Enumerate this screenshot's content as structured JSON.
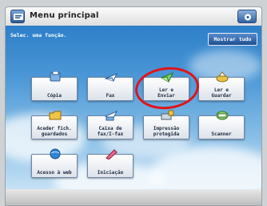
{
  "window": {
    "title": "Menu principal"
  },
  "screen": {
    "subtitle": "Selec. uma função.",
    "show_all_label": "Mostrar tudo"
  },
  "tiles": [
    {
      "label": "Cópia",
      "icon": "copy-icon"
    },
    {
      "label": "Fax",
      "icon": "fax-icon"
    },
    {
      "label": "Ler e\nEnviar",
      "icon": "scan-send-icon"
    },
    {
      "label": "Ler e\nGuardar",
      "icon": "scan-store-icon"
    },
    {
      "label": "Aceder fich.\nguardados",
      "icon": "folder-icon"
    },
    {
      "label": "Caixa de\nfax/I-fax",
      "icon": "fax-inbox-icon"
    },
    {
      "label": "Impressão\nprotegida",
      "icon": "secure-print-icon"
    },
    {
      "label": "Scanner",
      "icon": "scanner-icon"
    },
    {
      "label": "Acesso à web",
      "icon": "web-icon"
    },
    {
      "label": "Iniciação",
      "icon": "pen-icon"
    }
  ],
  "colors": {
    "accent": "#1e4f92",
    "highlight": "#e0141b"
  }
}
